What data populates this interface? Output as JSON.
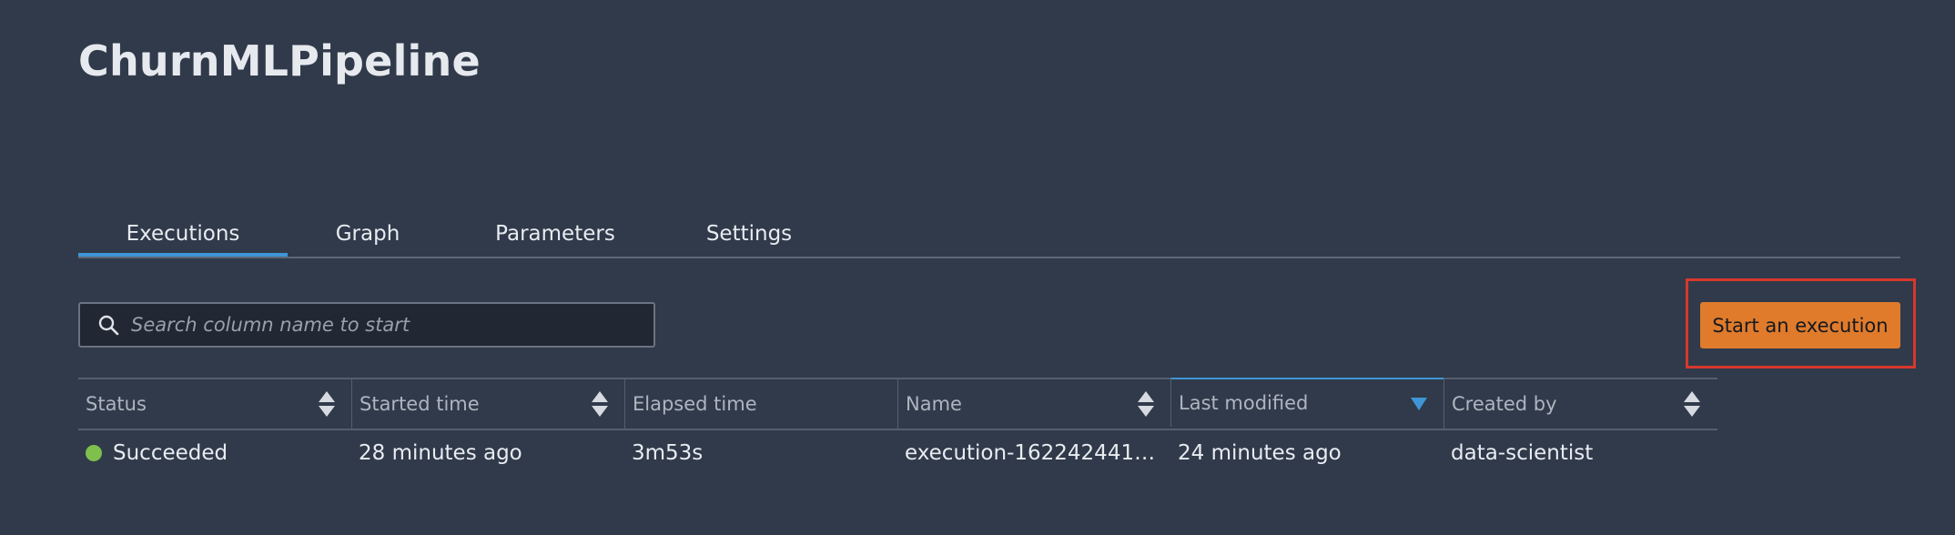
{
  "page": {
    "title": "ChurnMLPipeline"
  },
  "tabs": [
    {
      "label": "Executions",
      "active": true
    },
    {
      "label": "Graph",
      "active": false
    },
    {
      "label": "Parameters",
      "active": false
    },
    {
      "label": "Settings",
      "active": false
    }
  ],
  "search": {
    "placeholder": "Search column name to start",
    "value": "",
    "icon": "search-icon"
  },
  "actions": {
    "start_label": "Start an execution"
  },
  "table": {
    "columns": [
      {
        "label": "Status",
        "sort": "sortable"
      },
      {
        "label": "Started time",
        "sort": "sortable"
      },
      {
        "label": "Elapsed time",
        "sort": "none"
      },
      {
        "label": "Name",
        "sort": "sortable"
      },
      {
        "label": "Last modified",
        "sort": "descending"
      },
      {
        "label": "Created by",
        "sort": "sortable"
      }
    ],
    "rows": [
      {
        "status": "Succeeded",
        "started_time": "28 minutes ago",
        "elapsed_time": "3m53s",
        "name": "execution-1622424414...",
        "last_modified": "24 minutes ago",
        "created_by": "data-scientist"
      }
    ]
  },
  "colors": {
    "background": "#303a4a",
    "accent": "#3f96d6",
    "primary_button": "#e07b2c",
    "success": "#7fbf4d",
    "highlight": "#d6382c"
  }
}
